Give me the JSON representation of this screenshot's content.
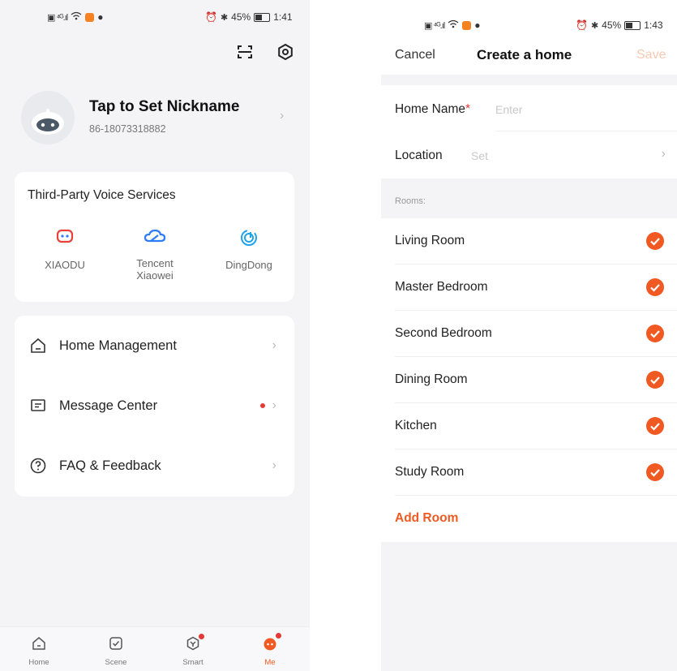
{
  "left": {
    "status_bar": {
      "battery": "45%",
      "time": "1:41"
    },
    "profile": {
      "nickname": "Tap to Set Nickname",
      "phone": "86-18073318882"
    },
    "voice_services": {
      "title": "Third-Party Voice Services",
      "items": [
        {
          "label": "XIAODU",
          "icon": "xiaodu-icon"
        },
        {
          "label": "Tencent\nXiaowei",
          "icon": "tencent-cloud-icon"
        },
        {
          "label": "DingDong",
          "icon": "dingdong-icon"
        }
      ]
    },
    "menu": [
      {
        "label": "Home Management",
        "icon": "home-icon"
      },
      {
        "label": "Message Center",
        "icon": "message-icon",
        "has_dot": true
      },
      {
        "label": "FAQ & Feedback",
        "icon": "question-icon"
      }
    ],
    "tabbar": [
      {
        "label": "Home",
        "icon": "home-tab-icon"
      },
      {
        "label": "Scene",
        "icon": "scene-tab-icon"
      },
      {
        "label": "Smart",
        "icon": "smart-tab-icon"
      },
      {
        "label": "Me",
        "icon": "me-tab-icon",
        "active": true
      }
    ]
  },
  "right": {
    "status_bar": {
      "battery": "45%",
      "time": "1:43"
    },
    "nav": {
      "cancel": "Cancel",
      "title": "Create a home",
      "save": "Save"
    },
    "home_name": {
      "label": "Home Name",
      "required_mark": "*",
      "placeholder": "Enter"
    },
    "location": {
      "label": "Location",
      "placeholder": "Set"
    },
    "rooms_header": "Rooms:",
    "rooms": [
      {
        "label": "Living Room",
        "checked": true
      },
      {
        "label": "Master Bedroom",
        "checked": true
      },
      {
        "label": "Second Bedroom",
        "checked": true
      },
      {
        "label": "Dining Room",
        "checked": true
      },
      {
        "label": "Kitchen",
        "checked": true
      },
      {
        "label": "Study Room",
        "checked": true
      }
    ],
    "add_room": "Add Room"
  },
  "colors": {
    "accent": "#f05a22",
    "save_disabled": "#f8c9b2",
    "icon_blue": "#2e7bf6",
    "badge_red": "#e53935"
  }
}
